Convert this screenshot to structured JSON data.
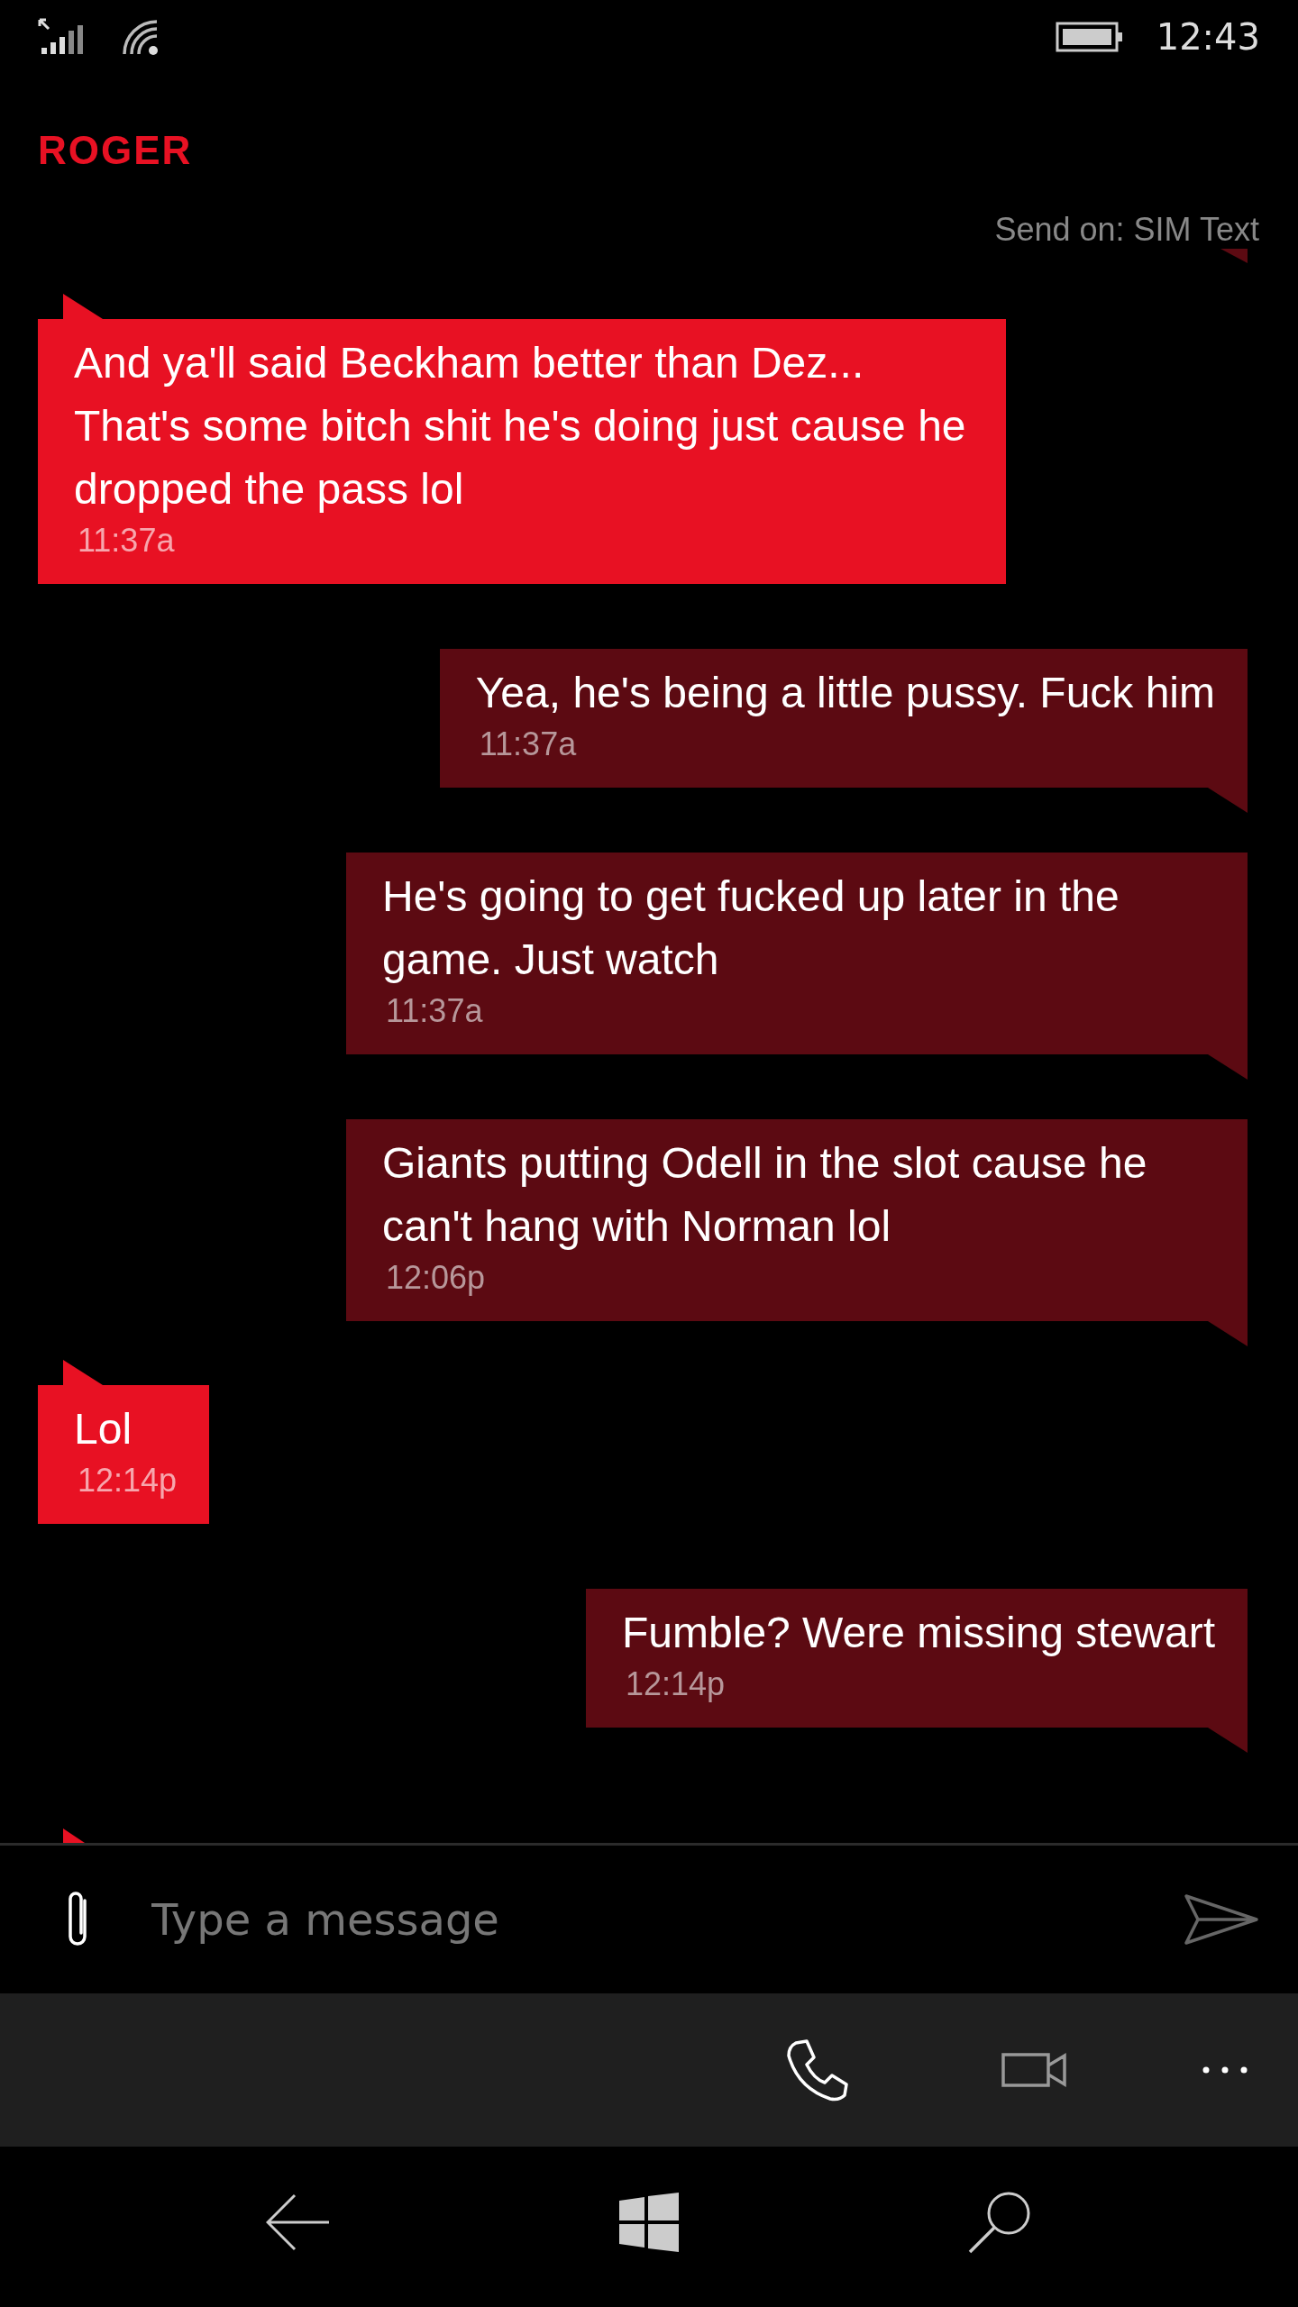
{
  "status_bar": {
    "time": "12:43"
  },
  "contact": {
    "name": "ROGER"
  },
  "send_on": "Send on: SIM Text",
  "messages": [
    {
      "kind": "incoming",
      "text": "And ya'll said Beckham better than Dez... That's some bitch shit he's doing just cause he dropped the pass lol",
      "time": "11:37a"
    },
    {
      "kind": "outgoing",
      "text": "Yea, he's being a little pussy. Fuck him",
      "time": "11:37a"
    },
    {
      "kind": "outgoing",
      "text": "He's going to get fucked up later in the game. Just watch",
      "time": "11:37a"
    },
    {
      "kind": "outgoing",
      "text": "Giants putting Odell in the slot cause he can't hang with Norman lol",
      "time": "12:06p"
    },
    {
      "kind": "incoming",
      "text": "Lol",
      "time": "12:14p"
    },
    {
      "kind": "outgoing",
      "text": "Fumble? Were missing stewart",
      "time": "12:14p"
    }
  ],
  "composer": {
    "placeholder": "Type a message"
  }
}
